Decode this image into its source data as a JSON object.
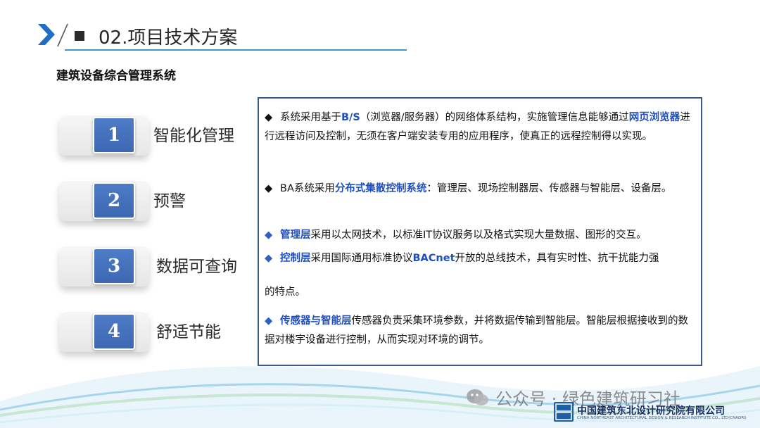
{
  "header": {
    "title": "02.项目技术方案",
    "subtitle": "建筑设备综合管理系统"
  },
  "items": [
    {
      "number": "1",
      "label": "智能化管理"
    },
    {
      "number": "2",
      "label": "预警"
    },
    {
      "number": "3",
      "label": "数据可查询"
    },
    {
      "number": "4",
      "label": "舒适节能"
    }
  ],
  "content": {
    "p1": {
      "bullet": "◆",
      "t1": "系统采用基于",
      "h1": "B/S",
      "t2": "（浏览器/服务器）的网络体系结构，实施管理信息能够通过",
      "h2": "网页浏览器",
      "t3": "进行远程访问及控制，无须在客户端安装专用的应用程序，使真正的远程控制得以实现。"
    },
    "p2": {
      "bullet": "◆",
      "t1": "BA系统采用",
      "h1": "分布式集散控制系统",
      "t2": "：管理层、现场控制器层、传感器与智能层、设备层。"
    },
    "p3": {
      "bullet": "◆",
      "h1": "管理层",
      "t1": "采用以太网技术，以标准IT协议服务以及格式实现大量数据、图形的交互。"
    },
    "p4": {
      "bullet": "◆",
      "h1": "控制层",
      "t1": "采用国际通用标准协议",
      "h2": "BACnet",
      "t2": "开放的总线技术，具有实时性、抗干扰能力强"
    },
    "p4b": {
      "t1": "的特点。"
    },
    "p5": {
      "bullet": "◆",
      "h1": "传感器与智能层",
      "t1": "传感器负责采集环境参数，并将数据传输到智能层。智能层根据接收到的数据对楼宇设备进行控制，从而实现对环境的调节。"
    }
  },
  "footer": {
    "watermark": "公众号 · 绿色建筑研习社",
    "company_cn": "中国建筑东北设计研究院有限公司",
    "company_en": "CHINA NORTHEAST ARCHITECTURAL DESIGN & RESEARCH INSTITUTE CO., LTD(CNADRI)"
  },
  "colors": {
    "accent_blue": "#3d67b2",
    "highlight_blue": "#1f4fbf",
    "header_line": "#3e9bc7",
    "box_border": "#3b5a88"
  }
}
